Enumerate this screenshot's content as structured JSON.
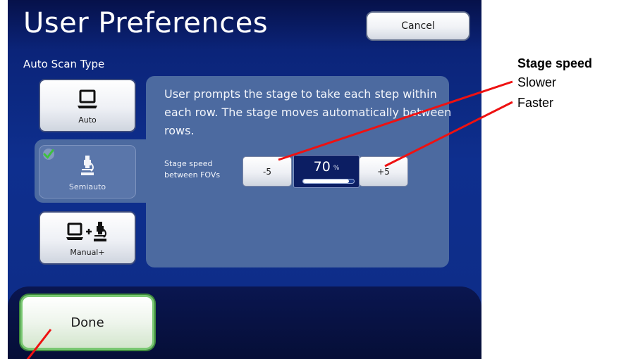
{
  "window": {
    "title": "User Preferences"
  },
  "toolbar": {
    "cancel_label": "Cancel"
  },
  "section": {
    "label": "Auto Scan Type"
  },
  "modes": {
    "auto": {
      "label": "Auto",
      "icon": "laptop-icon"
    },
    "semiauto": {
      "label": "Semiauto",
      "icon": "microscope-icon",
      "selected": true
    },
    "manual": {
      "label": "Manual+",
      "icon": "laptop-plus-microscope-icon"
    }
  },
  "description": "User prompts the stage to take each step within each row.   The stage moves automatically between rows.",
  "speed": {
    "label_line1": "Stage speed",
    "label_line2": "between FOVs",
    "minus_label": "-5",
    "plus_label": "+5",
    "value": "70",
    "unit": "%",
    "fraction": 0.9
  },
  "footer": {
    "done_label": "Done"
  },
  "annotations": {
    "title": "Stage speed",
    "slower": "Slower",
    "faster": "Faster",
    "line_color": "#ee1111"
  },
  "colors": {
    "accent_check": "#3ec23e",
    "done_border": "#7ac873"
  }
}
